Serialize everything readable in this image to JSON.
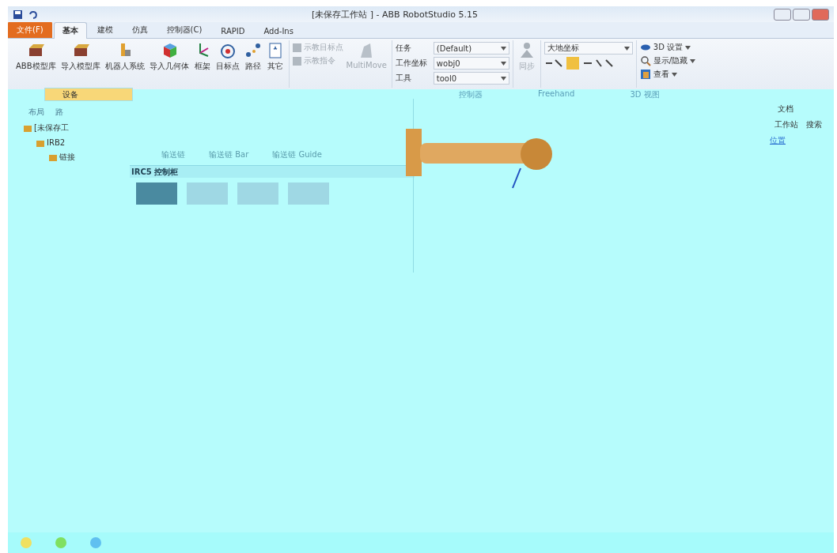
{
  "window": {
    "title": "[未保存工作站 ] - ABB RobotStudio 5.15"
  },
  "tabs": [
    {
      "label": "文件(F)",
      "kind": "file",
      "selected": false
    },
    {
      "label": "基本",
      "kind": "tab",
      "selected": true
    },
    {
      "label": "建模",
      "kind": "tab",
      "selected": false
    },
    {
      "label": "仿真",
      "kind": "tab",
      "selected": false
    },
    {
      "label": "控制器(C)",
      "kind": "tab",
      "selected": false
    },
    {
      "label": "RAPID",
      "kind": "tab",
      "selected": false
    },
    {
      "label": "Add-Ins",
      "kind": "tab",
      "selected": false
    }
  ],
  "ribbon": {
    "buttons": [
      {
        "label": "ABB模型库"
      },
      {
        "label": "导入模型库"
      },
      {
        "label": "机器人系统"
      },
      {
        "label": "导入几何体"
      },
      {
        "label": "框架"
      },
      {
        "label": "目标点"
      },
      {
        "label": "路径"
      },
      {
        "label": "其它"
      }
    ],
    "teach": [
      {
        "label": "示教目标点",
        "disabled": true
      },
      {
        "label": "示教指令",
        "disabled": true
      }
    ],
    "multimove": {
      "label": "MultiMove",
      "disabled": true
    },
    "settings": [
      {
        "label": "任务",
        "value": "(Default)"
      },
      {
        "label": "工作坐标",
        "value": "wobj0"
      },
      {
        "label": "工具",
        "value": "tool0"
      }
    ],
    "sync": {
      "label": "同步",
      "disabled": true
    },
    "frame_select": {
      "value": "大地坐标"
    },
    "view": [
      {
        "label": "3D 设置"
      },
      {
        "label": "显示/隐藏"
      },
      {
        "label": "查看"
      }
    ],
    "group_labels": [
      "控制器",
      "Freehand",
      "3D 视图"
    ]
  },
  "menu": {
    "items": [
      {
        "label": "设备",
        "selected": true
      }
    ]
  },
  "left_panel": {
    "tabs": [
      "布局",
      "路"
    ],
    "tree": [
      {
        "label": "[未保存工",
        "children": [
          {
            "label": "IRB2",
            "children": [
              {
                "label": "链接"
              }
            ]
          }
        ]
      }
    ]
  },
  "gallery": {
    "labels": [
      "输送链",
      "输送链 Bar",
      "输送链 Guide"
    ],
    "section": "IRC5 控制柜"
  },
  "right_panel": {
    "title": "文档",
    "tabs": [
      "工作站",
      "搜索"
    ],
    "link": "位置"
  }
}
